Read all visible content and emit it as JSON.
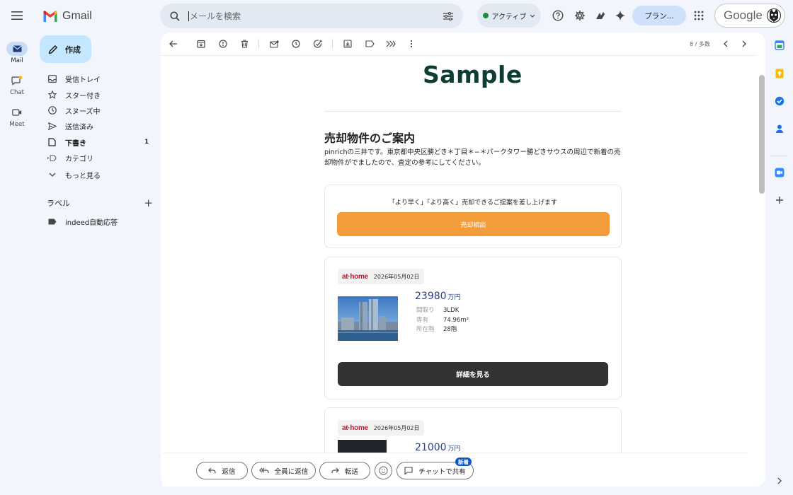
{
  "rail": {
    "items": [
      {
        "label": "Mail",
        "icon": "mail-icon"
      },
      {
        "label": "Chat",
        "icon": "chat-icon"
      },
      {
        "label": "Meet",
        "icon": "meet-icon"
      }
    ]
  },
  "header": {
    "app_name": "Gmail",
    "search_placeholder": "メールを検索",
    "status_label": "アクティブ",
    "plan_label": "プラン...",
    "account_label": "Google"
  },
  "nav": {
    "compose_label": "作成",
    "items": [
      {
        "label": "受信トレイ",
        "icon": "inbox-icon"
      },
      {
        "label": "スター付き",
        "icon": "star-icon"
      },
      {
        "label": "スヌーズ中",
        "icon": "snooze-icon"
      },
      {
        "label": "送信済み",
        "icon": "sent-icon"
      },
      {
        "label": "下書き",
        "icon": "draft-icon",
        "count": "1"
      },
      {
        "label": "カテゴリ",
        "icon": "category-icon"
      },
      {
        "label": "もっと見る",
        "icon": "chevron-down-icon"
      }
    ],
    "labels_heading": "ラベル",
    "labels_add": "+",
    "labels": [
      {
        "label": "indeed自動応答",
        "icon": "label-icon"
      }
    ]
  },
  "toolbar": {
    "page_count": "8 / 多数"
  },
  "email": {
    "logo_text": "Sample",
    "heading": "売却物件のご案内",
    "intro": "pinrichの三井です。東京都中央区勝どき＊丁目＊−＊パークタワー勝どきサウスの周辺で新着の売却物件がでましたので、査定の参考にしてください。",
    "cta_text": "「より早く」「より高く」売却できるご提案を差し上げます",
    "cta_button": "売却相談",
    "listings": [
      {
        "source": "at·home",
        "date": "2026年05月02日",
        "price": "23980",
        "price_unit": "万円",
        "layout_key": "間取り",
        "layout_value": "3LDK",
        "area_key": "専有",
        "area_value": "74.96m²",
        "floor_key": "所在階",
        "floor_value": "28階",
        "detail_button": "詳細を見る"
      },
      {
        "source": "at·home",
        "date": "2026年05月02日",
        "price": "21000",
        "price_unit": "万円"
      }
    ]
  },
  "reply_bar": {
    "reply": "返信",
    "reply_all": "全員に返信",
    "forward": "転送",
    "share_chat": "チャットで共有",
    "new_badge": "新着"
  },
  "colors": {
    "accent_orange": "#f29c3a",
    "dark_button": "#333333",
    "logo_green": "#0f3d33",
    "price_blue": "#2a3f8f",
    "gmail_blue": "#0b57d0"
  }
}
